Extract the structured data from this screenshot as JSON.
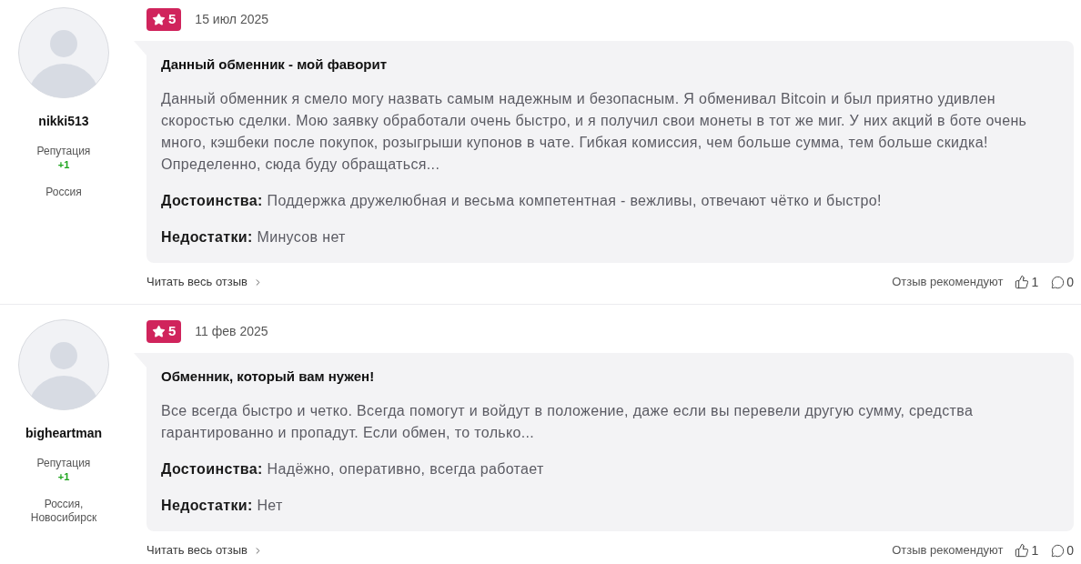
{
  "reviews": [
    {
      "author": {
        "name": "nikki513",
        "reputation_label": "Репутация",
        "reputation": "+1",
        "location": "Россия"
      },
      "rating": "5",
      "date": "15 июл 2025",
      "title": "Данный обменник - мой фаворит",
      "text": "Данный обменник я смело могу назвать самым надежным и безопасным. Я обменивал Bitcoin и был приятно удивлен скоростью сделки. Мою заявку обработали очень быстро, и я получил свои монеты в тот же миг. У них акций в боте очень много, кэшбеки после покупок, розыгрыши купонов в чате. Гибкая комиссия, чем больше сумма, тем больше скидка! Определенно, сюда буду обращаться...",
      "pros": {
        "label": "Достоинства:",
        "text": "Поддержка дружелюбная и весьма компетентная - вежливы, отвечают чётко и быстро!"
      },
      "cons": {
        "label": "Недостатки:",
        "text": "Минусов нет"
      },
      "read_more": "Читать весь отзыв",
      "recommend_label": "Отзыв рекомендуют",
      "likes": "1",
      "comments": "0"
    },
    {
      "author": {
        "name": "bigheartman",
        "reputation_label": "Репутация",
        "reputation": "+1",
        "location": "Россия, Новосибирск"
      },
      "rating": "5",
      "date": "11 фев 2025",
      "title": "Обменник, который вам нужен!",
      "text": "Все всегда быстро и четко. Всегда помогут и войдут в положение, даже если вы перевели другую сумму, средства гарантированно и пропадут. Если обмен, то только...",
      "pros": {
        "label": "Достоинства:",
        "text": "Надёжно, оперативно, всегда работает"
      },
      "cons": {
        "label": "Недостатки:",
        "text": "Нет"
      },
      "read_more": "Читать весь отзыв",
      "recommend_label": "Отзыв рекомендуют",
      "likes": "1",
      "comments": "0"
    }
  ]
}
